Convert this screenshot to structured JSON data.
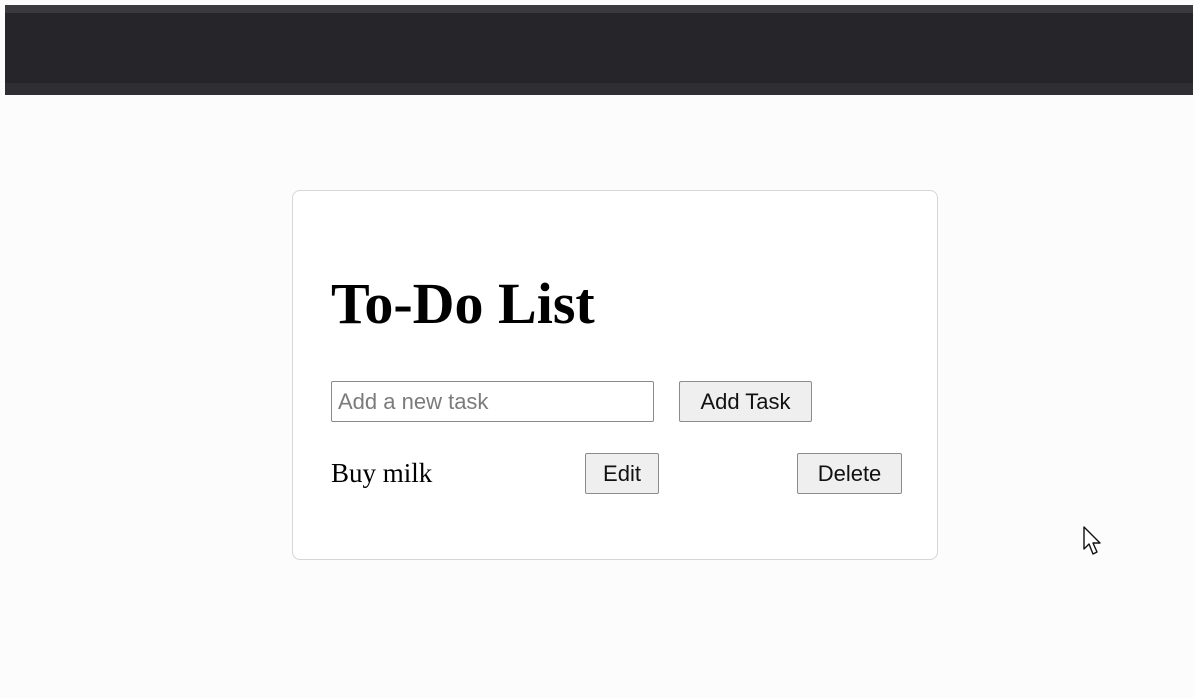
{
  "app": {
    "title": "To-Do List"
  },
  "new_task": {
    "value": "",
    "placeholder": "Add a new task",
    "add_label": "Add Task"
  },
  "tasks": [
    {
      "text": "Buy milk",
      "edit_label": "Edit",
      "delete_label": "Delete"
    }
  ],
  "icons": {
    "cursor": "mouse-pointer-icon"
  },
  "colors": {
    "top_bar": "#26252a",
    "page_background": "#fcfcfd",
    "card_border": "#d6d6d9",
    "button_background": "#efefef"
  }
}
